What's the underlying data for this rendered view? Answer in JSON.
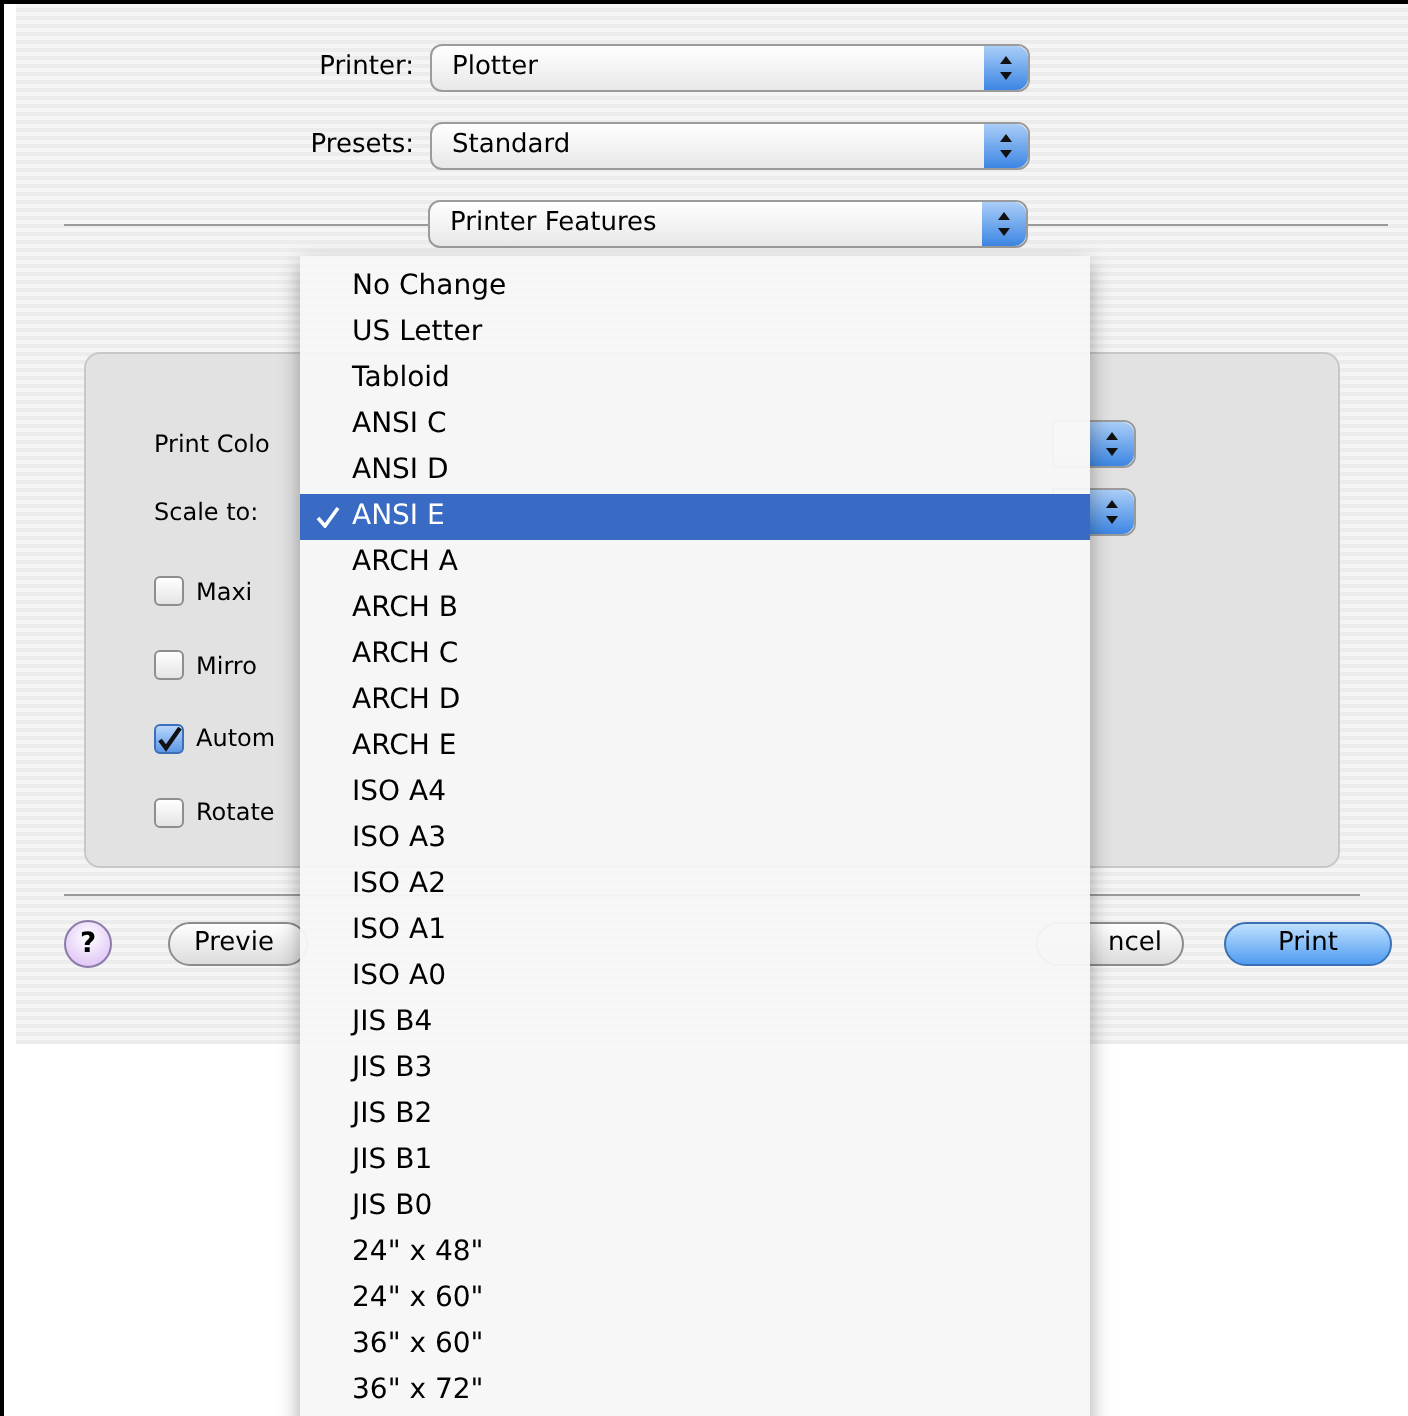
{
  "dialog": {
    "printer": {
      "label": "Printer:",
      "value": "Plotter"
    },
    "presets": {
      "label": "Presets:",
      "value": "Standard"
    },
    "panel_menu": {
      "value": "Printer Features"
    },
    "options": [
      {
        "kind": "popup",
        "label": "Print Colo"
      },
      {
        "kind": "popup",
        "label": "Scale to:"
      },
      {
        "kind": "checkbox",
        "label": "Maxi",
        "checked": false
      },
      {
        "kind": "checkbox",
        "label": "Mirro",
        "checked": false
      },
      {
        "kind": "checkbox",
        "label": "Autom",
        "checked": true
      },
      {
        "kind": "checkbox",
        "label": "Rotate",
        "checked": false
      }
    ],
    "buttons": [
      {
        "kind": "help",
        "label": "?"
      },
      {
        "kind": "normal",
        "label": "Previe"
      },
      {
        "kind": "normal",
        "label": "ncel"
      },
      {
        "kind": "default",
        "label": "Print"
      }
    ]
  },
  "menu": {
    "items": [
      {
        "label": "No Change",
        "selected": false
      },
      {
        "label": "US Letter",
        "selected": false
      },
      {
        "label": "Tabloid",
        "selected": false
      },
      {
        "label": "ANSI C",
        "selected": false
      },
      {
        "label": "ANSI D",
        "selected": false
      },
      {
        "label": "ANSI E",
        "selected": true
      },
      {
        "label": "ARCH A",
        "selected": false
      },
      {
        "label": "ARCH B",
        "selected": false
      },
      {
        "label": "ARCH C",
        "selected": false
      },
      {
        "label": "ARCH D",
        "selected": false
      },
      {
        "label": "ARCH E",
        "selected": false
      },
      {
        "label": "ISO A4",
        "selected": false
      },
      {
        "label": "ISO A3",
        "selected": false
      },
      {
        "label": "ISO A2",
        "selected": false
      },
      {
        "label": "ISO A1",
        "selected": false
      },
      {
        "label": "ISO A0",
        "selected": false
      },
      {
        "label": "JIS B4",
        "selected": false
      },
      {
        "label": "JIS B3",
        "selected": false
      },
      {
        "label": "JIS B2",
        "selected": false
      },
      {
        "label": "JIS B1",
        "selected": false
      },
      {
        "label": "JIS B0",
        "selected": false
      },
      {
        "label": "24\" x 48\"",
        "selected": false
      },
      {
        "label": "24\" x 60\"",
        "selected": false
      },
      {
        "label": "36\" x 60\"",
        "selected": false
      },
      {
        "label": "36\" x 72\"",
        "selected": false
      }
    ]
  }
}
